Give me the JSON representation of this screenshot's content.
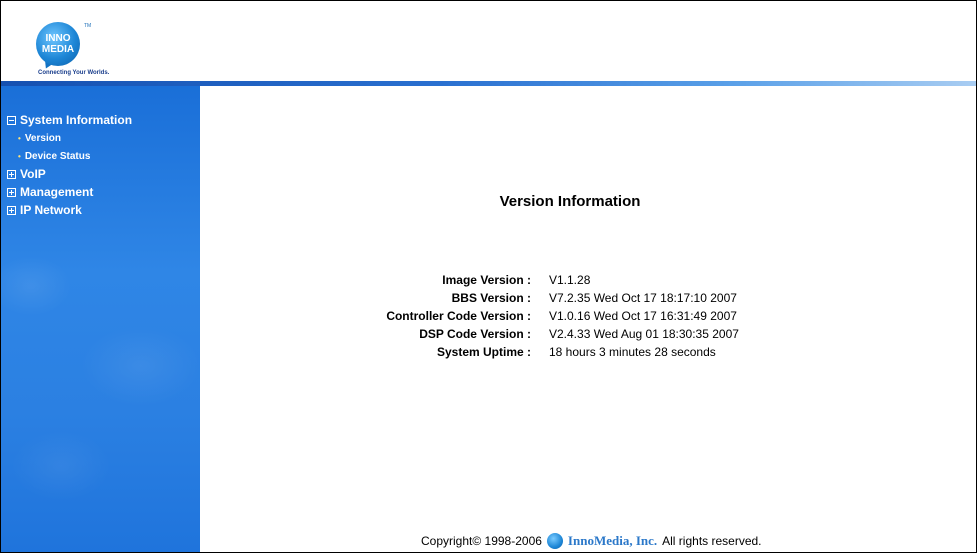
{
  "header": {
    "logo_line1": "INNO",
    "logo_line2": "MEDIA",
    "logo_tm": "TM",
    "tagline": "Connecting Your Worlds."
  },
  "sidebar": {
    "items": [
      {
        "label": "System Information",
        "state": "expanded"
      },
      {
        "label": "VoIP",
        "state": "collapsed"
      },
      {
        "label": "Management",
        "state": "collapsed"
      },
      {
        "label": "IP Network",
        "state": "collapsed"
      }
    ],
    "system_info_children": [
      {
        "label": "Version"
      },
      {
        "label": "Device Status"
      }
    ]
  },
  "main": {
    "title": "Version Information",
    "rows": [
      {
        "label": "Image Version :",
        "value": "V1.1.28"
      },
      {
        "label": "BBS Version :",
        "value": "V7.2.35 Wed Oct 17 18:17:10 2007"
      },
      {
        "label": "Controller Code Version :",
        "value": "V1.0.16 Wed Oct 17 16:31:49 2007"
      },
      {
        "label": "DSP Code Version :",
        "value": "V2.4.33 Wed Aug 01 18:30:35 2007"
      },
      {
        "label": "System Uptime :",
        "value": "18 hours 3 minutes 28 seconds"
      }
    ]
  },
  "footer": {
    "copyright": "Copyright© 1998-2006",
    "company": "InnoMedia, Inc.",
    "rights": "All rights reserved."
  },
  "colors": {
    "sidebar_blue": "#2b80e2",
    "header_rule": "#1550b0",
    "company_blue": "#2b78c9"
  }
}
